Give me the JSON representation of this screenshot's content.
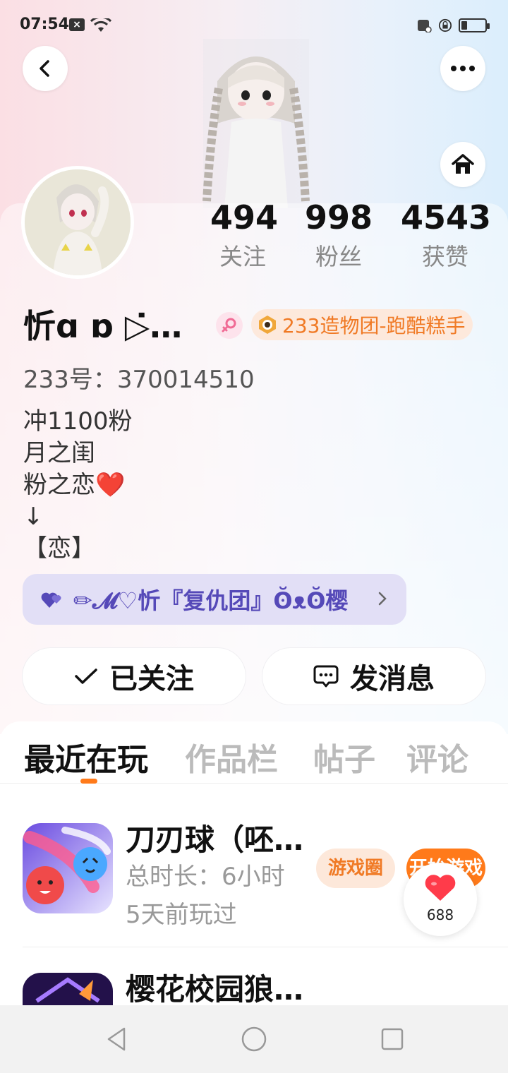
{
  "status_bar": {
    "time": "07:54",
    "notification_icon": "x-box-icon"
  },
  "profile": {
    "username": "忻ɑ ︎ɒ ▷̇…",
    "group_badge": "233造物团-跑酷糕手",
    "uid": "233号：370014510",
    "bio_lines": [
      "冲1100粉",
      "月之闺",
      "粉之恋❤️",
      "↓",
      "【恋】"
    ]
  },
  "stats": [
    {
      "value": "494",
      "label": "关注"
    },
    {
      "value": "998",
      "label": "粉丝"
    },
    {
      "value": "4543",
      "label": "获赞"
    }
  ],
  "guild": {
    "label": "✏𝓜♡忻『复仇团』ʘ̆ᴥʘ̆樱"
  },
  "actions": {
    "follow_label": "已关注",
    "message_label": "发消息"
  },
  "tabs": [
    "最近在玩",
    "作品栏",
    "帖子",
    "评论"
  ],
  "games": [
    {
      "title": "刀刃球（呸…",
      "playtime": "总时长：6小时",
      "last_played": "5天前玩过",
      "circle_label": "游戏圈",
      "play_label": "开始游戏"
    },
    {
      "title": "樱花校园狼…"
    }
  ],
  "like_fab": {
    "count": "688"
  },
  "colors": {
    "accent": "#ff7a1a",
    "badge_orange": "#f07a25",
    "guild_purple": "#5549b8"
  }
}
